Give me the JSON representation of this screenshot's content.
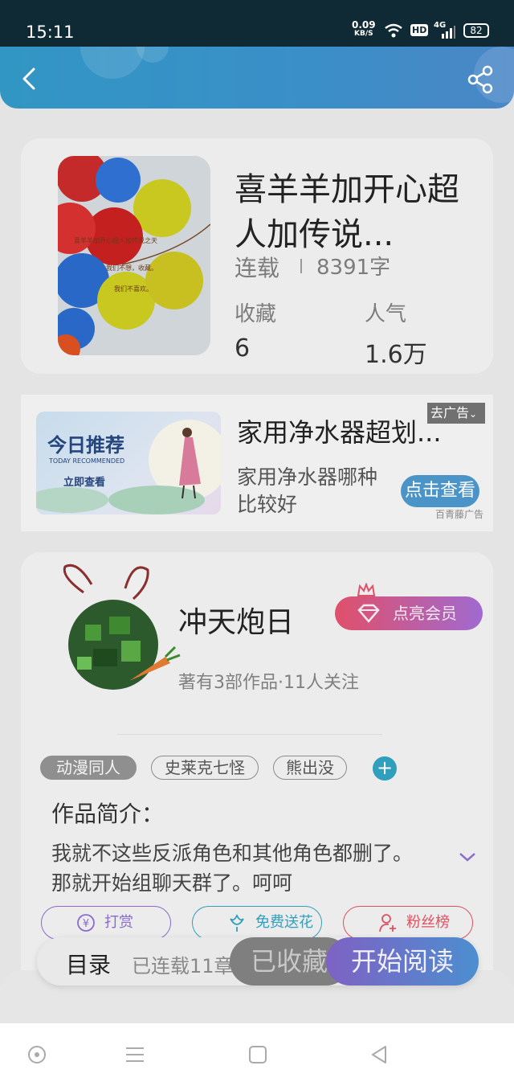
{
  "status_bar": {
    "time": "15:11",
    "net_speed": "0.09",
    "net_speed_unit": "KB/S",
    "hd": "HD",
    "network": "4G",
    "battery": "82"
  },
  "colors": {
    "header": "#3a8fc8",
    "accent_cyan": "#2f9fbd",
    "vip_gradient_start": "#e0506a",
    "vip_gradient_end": "#a06ad0",
    "read_gradient_start": "#7e62c4",
    "read_gradient_end": "#4c8ed0"
  },
  "book": {
    "title": "喜羊羊加开心超人加传说...",
    "status": "连载",
    "word_count": "8391字",
    "favorites_label": "收藏",
    "favorites_value": "6",
    "popularity_label": "人气",
    "popularity_value": "1.6万",
    "cover_text": [
      "喜羊羊加开心超人加传说之天",
      "我们不想，收藏。",
      "我们不喜欢。"
    ]
  },
  "ad": {
    "image_title": "今日推荐",
    "image_subtitle": "TODAY RECOMMENDED",
    "image_button": "立即查看",
    "close_label": "去广告",
    "title": "家用净水器超划...",
    "description": "家用净水器哪种比较好",
    "button": "点击查看",
    "source": "百青藤广告"
  },
  "author": {
    "name": "冲天炮日",
    "vip_button": "点亮会员",
    "info": "著有3部作品·11人关注"
  },
  "tags": [
    "动漫同人",
    "史莱克七怪",
    "熊出没"
  ],
  "intro": {
    "title": "作品简介：",
    "text": "我就不这些反派角色和其他角色都删了。那就开始组聊天群了。呵呵"
  },
  "actions": {
    "tip": "打赏",
    "flowers": "免费送花",
    "fans": "粉丝榜"
  },
  "bottom": {
    "catalog": "目录",
    "serialized": "已连载11章",
    "collected": "已收藏",
    "start_reading": "开始阅读"
  }
}
